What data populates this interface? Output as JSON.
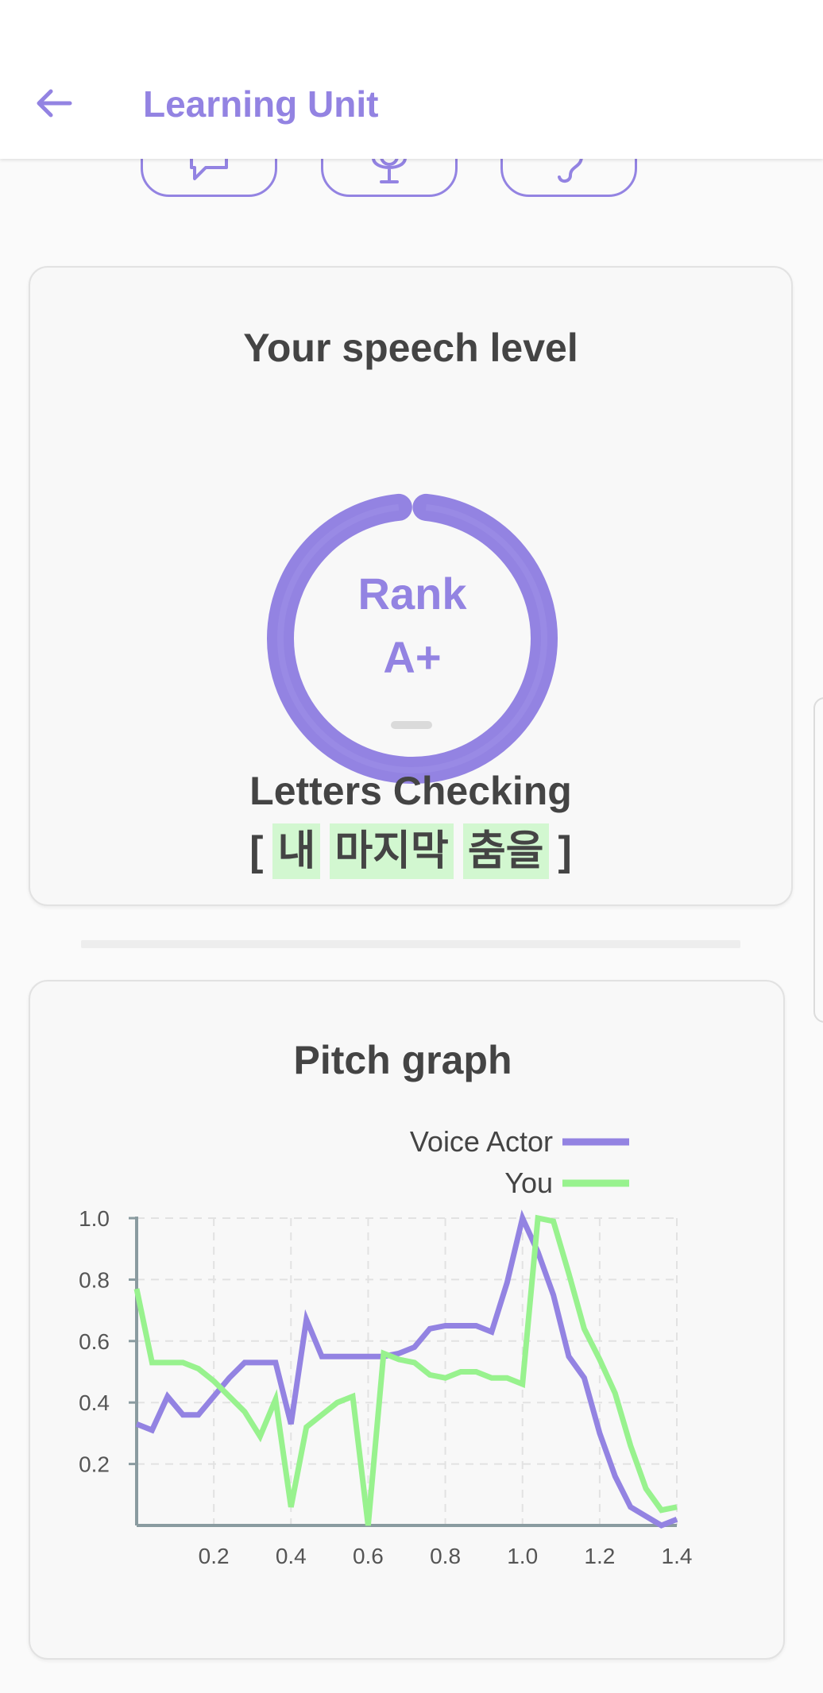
{
  "appbar": {
    "title": "Learning Unit",
    "back_icon": "arrow-left-icon"
  },
  "modes": [
    {
      "name": "speak-mode-button",
      "icon": "speech-bubble-icon"
    },
    {
      "name": "record-mode-button",
      "icon": "microphone-icon"
    },
    {
      "name": "listen-mode-button",
      "icon": "ear-icon"
    }
  ],
  "speech_card": {
    "title": "Your speech level",
    "rank_label": "Rank",
    "rank_value": "A+",
    "letters_title": "Letters Checking",
    "open_bracket": "[",
    "close_bracket": "]",
    "words": [
      "내",
      "마지막",
      "춤을"
    ]
  },
  "colors": {
    "accent": "#9383e2",
    "voice_actor": "#9383e2",
    "you": "#98f28e",
    "highlight": "#d2f7d0"
  },
  "pitch_card": {
    "title": "Pitch graph",
    "chart_data": {
      "type": "line",
      "title": "Pitch graph",
      "xlim": [
        0,
        1.4
      ],
      "ylim": [
        0,
        1.0
      ],
      "x_ticks": [
        "0.2",
        "0.4",
        "0.6",
        "0.8",
        "1.0",
        "1.2",
        "1.4"
      ],
      "y_ticks": [
        "0.2",
        "0.4",
        "0.6",
        "0.8",
        "1.0"
      ],
      "grid": true,
      "legend_position": "top-right",
      "series": [
        {
          "name": "Voice Actor",
          "color": "#9383e2",
          "x": [
            0,
            0.04,
            0.08,
            0.12,
            0.16,
            0.2,
            0.24,
            0.28,
            0.32,
            0.36,
            0.4,
            0.44,
            0.48,
            0.52,
            0.56,
            0.6,
            0.64,
            0.68,
            0.72,
            0.76,
            0.8,
            0.84,
            0.88,
            0.92,
            0.96,
            1.0,
            1.04,
            1.08,
            1.12,
            1.16,
            1.2,
            1.24,
            1.28,
            1.32,
            1.36,
            1.4
          ],
          "y": [
            0.33,
            0.31,
            0.42,
            0.36,
            0.36,
            0.42,
            0.48,
            0.53,
            0.53,
            0.53,
            0.33,
            0.67,
            0.55,
            0.55,
            0.55,
            0.55,
            0.55,
            0.56,
            0.58,
            0.64,
            0.65,
            0.65,
            0.65,
            0.63,
            0.79,
            1.0,
            0.89,
            0.75,
            0.55,
            0.48,
            0.3,
            0.16,
            0.06,
            0.03,
            0.0,
            0.02
          ]
        },
        {
          "name": "You",
          "color": "#98f28e",
          "x": [
            0,
            0.04,
            0.08,
            0.12,
            0.16,
            0.2,
            0.24,
            0.28,
            0.32,
            0.36,
            0.4,
            0.44,
            0.48,
            0.52,
            0.56,
            0.6,
            0.64,
            0.68,
            0.72,
            0.76,
            0.8,
            0.84,
            0.88,
            0.92,
            0.96,
            1.0,
            1.04,
            1.08,
            1.12,
            1.16,
            1.2,
            1.24,
            1.28,
            1.32,
            1.36,
            1.4
          ],
          "y": [
            0.77,
            0.53,
            0.53,
            0.53,
            0.51,
            0.47,
            0.42,
            0.37,
            0.29,
            0.41,
            0.06,
            0.32,
            0.36,
            0.4,
            0.42,
            0.0,
            0.56,
            0.54,
            0.53,
            0.49,
            0.48,
            0.5,
            0.5,
            0.48,
            0.48,
            0.46,
            1.0,
            0.99,
            0.82,
            0.64,
            0.54,
            0.43,
            0.26,
            0.12,
            0.05,
            0.06
          ]
        }
      ]
    }
  }
}
